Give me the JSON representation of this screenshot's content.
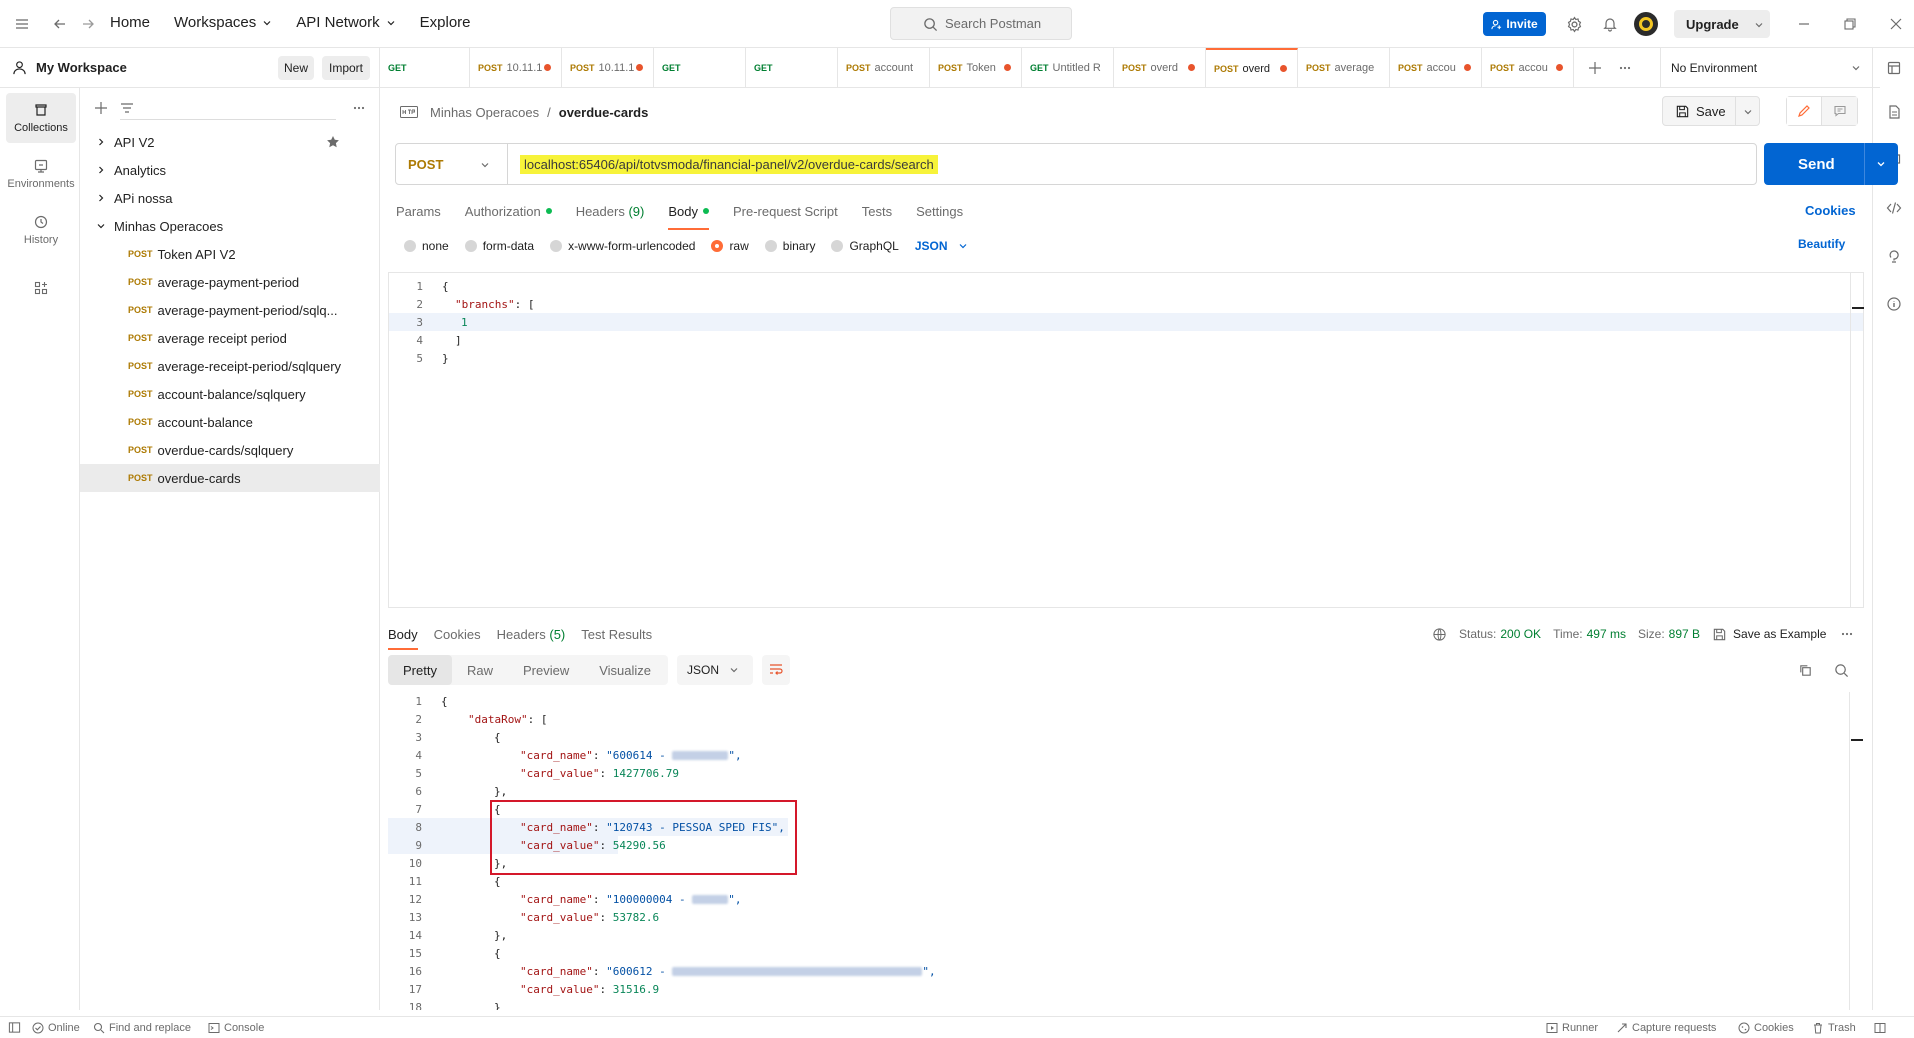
{
  "topbar": {
    "nav": [
      "Home",
      "Workspaces",
      "API Network",
      "Explore"
    ],
    "search_placeholder": "Search Postman",
    "invite_label": "Invite",
    "upgrade_label": "Upgrade"
  },
  "workspace": {
    "title": "My Workspace",
    "new_label": "New",
    "import_label": "Import"
  },
  "rail": [
    {
      "label": "Collections",
      "icon": "collections-icon"
    },
    {
      "label": "Environments",
      "icon": "environments-icon"
    },
    {
      "label": "History",
      "icon": "history-icon"
    }
  ],
  "tree": {
    "collections": [
      {
        "label": "API V2"
      },
      {
        "label": "Analytics"
      },
      {
        "label": "APi nossa"
      },
      {
        "label": "Minhas Operacoes"
      }
    ],
    "requests": [
      {
        "method": "POST",
        "label": "Token API V2"
      },
      {
        "method": "POST",
        "label": "average-payment-period"
      },
      {
        "method": "POST",
        "label": "average-payment-period/sqlq..."
      },
      {
        "method": "POST",
        "label": "average receipt period"
      },
      {
        "method": "POST",
        "label": "average-receipt-period/sqlquery"
      },
      {
        "method": "POST",
        "label": "account-balance/sqlquery"
      },
      {
        "method": "POST",
        "label": "account-balance"
      },
      {
        "method": "POST",
        "label": "overdue-cards/sqlquery"
      },
      {
        "method": "POST",
        "label": "overdue-cards"
      }
    ]
  },
  "tabs": [
    {
      "method": "GET",
      "label": ""
    },
    {
      "method": "POST",
      "label": "10.11.1"
    },
    {
      "method": "POST",
      "label": "10.11.1"
    },
    {
      "method": "GET",
      "label": ""
    },
    {
      "method": "GET",
      "label": ""
    },
    {
      "method": "POST",
      "label": "account"
    },
    {
      "method": "POST",
      "label": "Token"
    },
    {
      "method": "GET",
      "label": "Untitled R"
    },
    {
      "method": "POST",
      "label": "overd"
    },
    {
      "method": "POST",
      "label": "overd"
    },
    {
      "method": "POST",
      "label": "average"
    },
    {
      "method": "POST",
      "label": "accou"
    },
    {
      "method": "POST",
      "label": "accou"
    }
  ],
  "environment": "No Environment",
  "request": {
    "breadcrumb_parent": "Minhas Operacoes",
    "breadcrumb_sep": "/",
    "breadcrumb_current": "overdue-cards",
    "save_label": "Save",
    "method": "POST",
    "url": "localhost:65406/api/totvsmoda/financial-panel/v2/overdue-cards/search",
    "send_label": "Send",
    "subtabs": [
      "Params",
      "Authorization",
      "Headers",
      "(9)",
      "Body",
      "Pre-request Script",
      "Tests",
      "Settings"
    ],
    "cookies_label": "Cookies",
    "body_modes": [
      "none",
      "form-data",
      "x-www-form-urlencoded",
      "raw",
      "binary",
      "GraphQL"
    ],
    "body_format": "JSON",
    "beautify_label": "Beautify",
    "body_lines": [
      {
        "n": "1",
        "t": "{"
      },
      {
        "n": "2",
        "k": "\"branchs\"",
        "t": ": ["
      },
      {
        "n": "3",
        "v": "1"
      },
      {
        "n": "4",
        "t": "]"
      },
      {
        "n": "5",
        "t": "}"
      }
    ]
  },
  "response": {
    "tabs": [
      "Body",
      "Cookies",
      "Headers",
      "(5)",
      "Test Results"
    ],
    "status_label": "Status:",
    "status_value": "200 OK",
    "time_label": "Time:",
    "time_value": "497 ms",
    "size_label": "Size:",
    "size_value": "897 B",
    "save_example_label": "Save as Example",
    "views": [
      "Pretty",
      "Raw",
      "Preview",
      "Visualize"
    ],
    "format": "JSON",
    "lines": [
      {
        "n": "1",
        "t": "{"
      },
      {
        "n": "2",
        "k": "\"dataRow\"",
        "t": ": ["
      },
      {
        "n": "3",
        "t": "{"
      },
      {
        "n": "4",
        "k": "\"card_name\"",
        "s": "\"600614 - "
      },
      {
        "n": "5",
        "k": "\"card_value\"",
        "v": "1427706.79"
      },
      {
        "n": "6",
        "t": "},"
      },
      {
        "n": "7",
        "t": "{"
      },
      {
        "n": "8",
        "k": "\"card_name\"",
        "s": "\"120743 - PESSOA SPED FIS\","
      },
      {
        "n": "9",
        "k": "\"card_value\"",
        "v": "54290.56"
      },
      {
        "n": "10",
        "t": "},"
      },
      {
        "n": "11",
        "t": "{"
      },
      {
        "n": "12",
        "k": "\"card_name\"",
        "s": "\"100000004 - "
      },
      {
        "n": "13",
        "k": "\"card_value\"",
        "v": "53782.6"
      },
      {
        "n": "14",
        "t": "},"
      },
      {
        "n": "15",
        "t": "{"
      },
      {
        "n": "16",
        "k": "\"card_name\"",
        "s": "\"600612 - "
      },
      {
        "n": "17",
        "k": "\"card_value\"",
        "v": "31516.9"
      },
      {
        "n": "18",
        "t": "}"
      }
    ]
  },
  "statusbar": {
    "online": "Online",
    "find": "Find and replace",
    "console": "Console",
    "runner": "Runner",
    "capture": "Capture requests",
    "cookies": "Cookies",
    "trash": "Trash"
  },
  "colors": {
    "accent": "#ff6c37",
    "primary": "#0265d2",
    "post": "#ad7a03",
    "get": "#007f31",
    "highlight": "#f7f33a",
    "annotation": "#d4182a"
  }
}
